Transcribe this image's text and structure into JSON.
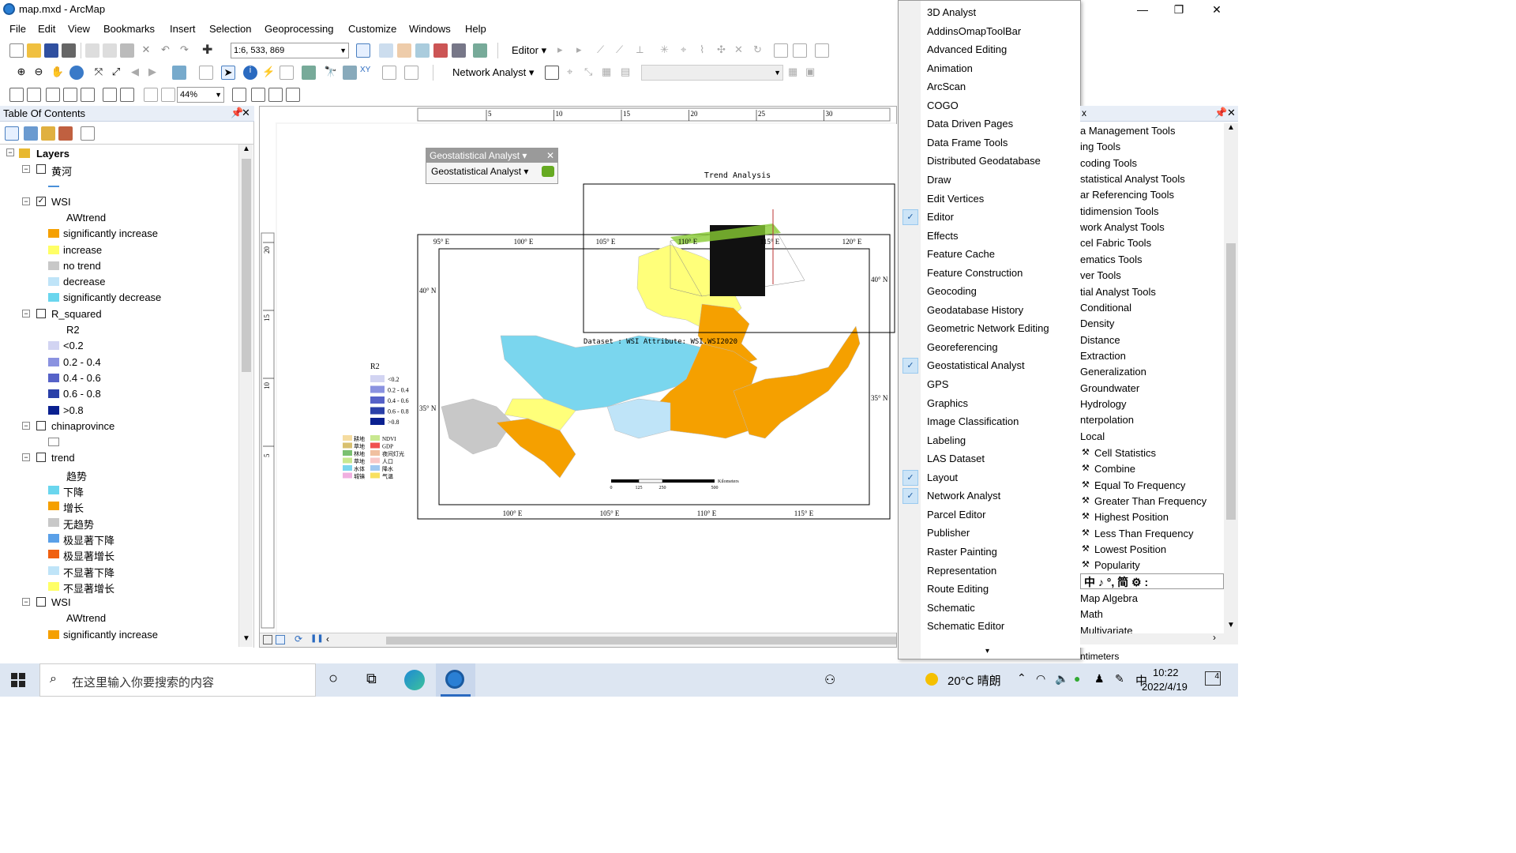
{
  "window": {
    "title": "map.mxd - ArcMap",
    "min": "—",
    "max": "❐",
    "close": "✕"
  },
  "menu": [
    "File",
    "Edit",
    "View",
    "Bookmarks",
    "Insert",
    "Selection",
    "Geoprocessing",
    "Customize",
    "Windows",
    "Help"
  ],
  "toolbar": {
    "scale": "1:6, 533, 869",
    "editor": "Editor",
    "network_analyst": "Network Analyst",
    "zoom": "44%"
  },
  "toc": {
    "title": "Table Of Contents",
    "root": "Layers",
    "rows": [
      {
        "label": "黄河",
        "type": "layer",
        "checked": false
      },
      {
        "label": "",
        "type": "line",
        "color": "#4a90d9"
      },
      {
        "label": "WSI",
        "type": "layer",
        "checked": true
      },
      {
        "label": "AWtrend",
        "type": "heading"
      },
      {
        "label": "significantly increase",
        "type": "swatch",
        "color": "#f5a000"
      },
      {
        "label": "increase",
        "type": "swatch",
        "color": "#ffff66"
      },
      {
        "label": "no trend",
        "type": "swatch",
        "color": "#c8c8c8"
      },
      {
        "label": "decrease",
        "type": "swatch",
        "color": "#bfe4f8"
      },
      {
        "label": "significantly decrease",
        "type": "swatch",
        "color": "#6ad6ee"
      },
      {
        "label": "R_squared",
        "type": "layer",
        "checked": false
      },
      {
        "label": "R2",
        "type": "heading"
      },
      {
        "label": "<0.2",
        "type": "swatch",
        "color": "#d2d4f2"
      },
      {
        "label": "0.2 - 0.4",
        "type": "swatch",
        "color": "#8a92e0"
      },
      {
        "label": "0.4 - 0.6",
        "type": "swatch",
        "color": "#5662c8"
      },
      {
        "label": "0.6 - 0.8",
        "type": "swatch",
        "color": "#2a40a8"
      },
      {
        "label": ">0.8",
        "type": "swatch",
        "color": "#0a2090"
      },
      {
        "label": "chinaprovince",
        "type": "layer",
        "checked": false
      },
      {
        "label": "",
        "type": "swatch",
        "color": "#ffffff"
      },
      {
        "label": "trend",
        "type": "layer",
        "checked": false
      },
      {
        "label": "趋势",
        "type": "heading"
      },
      {
        "label": "下降",
        "type": "swatch",
        "color": "#6ad6ee"
      },
      {
        "label": "增长",
        "type": "swatch",
        "color": "#f5a000"
      },
      {
        "label": "无趋势",
        "type": "swatch",
        "color": "#c8c8c8"
      },
      {
        "label": "极显著下降",
        "type": "swatch",
        "color": "#5aa0e8"
      },
      {
        "label": "极显著增长",
        "type": "swatch",
        "color": "#f06010"
      },
      {
        "label": "不显著下降",
        "type": "swatch",
        "color": "#bfe4f8"
      },
      {
        "label": "不显著增长",
        "type": "swatch",
        "color": "#ffff66"
      },
      {
        "label": "WSI",
        "type": "layer",
        "checked": false
      },
      {
        "label": "AWtrend",
        "type": "heading"
      },
      {
        "label": "significantly increase",
        "type": "swatch",
        "color": "#f5a000"
      }
    ]
  },
  "geo_toolbar": {
    "title": "Geostatistical Analyst",
    "button": "Geostatistical Analyst"
  },
  "ruler": {
    "top": [
      "5",
      "10",
      "15",
      "20",
      "25",
      "30"
    ],
    "left": [
      "20",
      "15",
      "10",
      "5"
    ]
  },
  "map": {
    "trend_title": "Trend Analysis",
    "dataset": "Dataset : WSI Attribute: WSI.WSI2020",
    "lon_top": [
      "95° E",
      "100° E",
      "105° E",
      "110° E",
      "115° E",
      "120° E"
    ],
    "lon_bottom": [
      "100° E",
      "105° E",
      "110° E",
      "115° E"
    ],
    "lat_left": [
      "40° N",
      "35° N"
    ],
    "lat_right": [
      "40° N",
      "35° N"
    ],
    "legend_title": "R2",
    "legend_items": [
      "<0.2",
      "0.2 - 0.4",
      "0.4 - 0.6",
      "0.6 - 0.8",
      ">0.8"
    ],
    "landuse_left": [
      "耕地",
      "草地",
      "林地",
      "草地",
      "水体",
      "城镇"
    ],
    "landuse_right": [
      "NDVI",
      "GDP",
      "夜间灯光",
      "人口",
      "降水",
      "气温"
    ],
    "scale_labels": [
      "0",
      "125",
      "250",
      "500"
    ],
    "scale_unit": "Kilometers"
  },
  "dropdown": {
    "items": [
      {
        "label": "3D Analyst",
        "checked": false
      },
      {
        "label": "AddinsOmapToolBar",
        "checked": false
      },
      {
        "label": "Advanced Editing",
        "checked": false
      },
      {
        "label": "Animation",
        "checked": false
      },
      {
        "label": "ArcScan",
        "checked": false
      },
      {
        "label": "COGO",
        "checked": false
      },
      {
        "label": "Data Driven Pages",
        "checked": false
      },
      {
        "label": "Data Frame Tools",
        "checked": false
      },
      {
        "label": "Distributed Geodatabase",
        "checked": false
      },
      {
        "label": "Draw",
        "checked": false
      },
      {
        "label": "Edit Vertices",
        "checked": false
      },
      {
        "label": "Editor",
        "checked": true
      },
      {
        "label": "Effects",
        "checked": false
      },
      {
        "label": "Feature Cache",
        "checked": false
      },
      {
        "label": "Feature Construction",
        "checked": false
      },
      {
        "label": "Geocoding",
        "checked": false
      },
      {
        "label": "Geodatabase History",
        "checked": false
      },
      {
        "label": "Geometric Network Editing",
        "checked": false
      },
      {
        "label": "Georeferencing",
        "checked": false
      },
      {
        "label": "Geostatistical Analyst",
        "checked": true
      },
      {
        "label": "GPS",
        "checked": false
      },
      {
        "label": "Graphics",
        "checked": false
      },
      {
        "label": "Image Classification",
        "checked": false
      },
      {
        "label": "Labeling",
        "checked": false
      },
      {
        "label": "LAS Dataset",
        "checked": false
      },
      {
        "label": "Layout",
        "checked": true
      },
      {
        "label": "Network Analyst",
        "checked": true
      },
      {
        "label": "Parcel Editor",
        "checked": false
      },
      {
        "label": "Publisher",
        "checked": false
      },
      {
        "label": "Raster Painting",
        "checked": false
      },
      {
        "label": "Representation",
        "checked": false
      },
      {
        "label": "Route Editing",
        "checked": false
      },
      {
        "label": "Schematic",
        "checked": false
      },
      {
        "label": "Schematic Editor",
        "checked": false
      }
    ],
    "more": "▾"
  },
  "arctoolbox": {
    "items": [
      "a Management Tools",
      "ing Tools",
      "coding Tools",
      "statistical Analyst Tools",
      "ar Referencing Tools",
      "tidimension Tools",
      "work Analyst Tools",
      "cel Fabric Tools",
      "ematics Tools",
      "ver Tools",
      "tial Analyst Tools",
      "Conditional",
      "Density",
      "Distance",
      "Extraction",
      "Generalization",
      "Groundwater",
      "Hydrology",
      "nterpolation",
      "Local"
    ],
    "tools": [
      "Cell Statistics",
      "Combine",
      "Equal To Frequency",
      "Greater Than Frequency",
      "Highest Position",
      "Less Than Frequency",
      "Lowest Position",
      "Popularity"
    ],
    "ime": "中 ♪ °, 简 ⚙ :",
    "more": [
      "Map Algebra",
      "Math",
      "Multivariate"
    ],
    "status": "ntimeters"
  },
  "taskbar": {
    "search": "在这里输入你要搜索的内容",
    "weather": "20°C  晴朗",
    "ime": "中",
    "time": "10:22",
    "date": "2022/4/19",
    "notif": "4"
  }
}
